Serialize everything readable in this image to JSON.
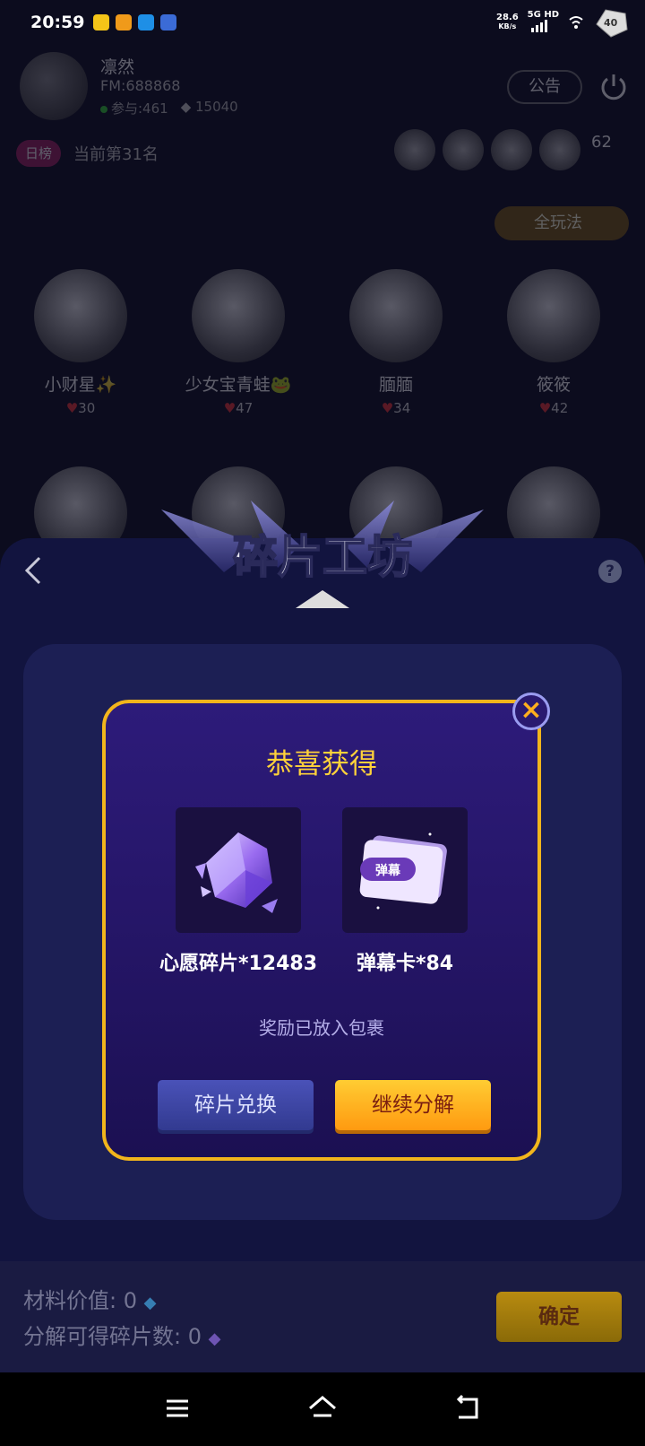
{
  "status_bar": {
    "time": "20:59",
    "net_speed": "28.6",
    "net_unit": "KB/s",
    "network": "5G HD",
    "battery": "40"
  },
  "room": {
    "host_name": "凛然",
    "host_id": "FM:688868",
    "participants": "参与:461",
    "diamonds": "15040",
    "notice_button": "公告",
    "rank_tag": "日榜",
    "rank_text": "当前第31名",
    "viewer_count": "62",
    "play_button": "全玩法",
    "seats": [
      {
        "name": "小财星✨",
        "hearts": "30"
      },
      {
        "name": "少女宝青蛙🐸",
        "hearts": "47"
      },
      {
        "name": "腼腼",
        "hearts": "34"
      },
      {
        "name": "筱筱",
        "hearts": "42"
      }
    ]
  },
  "workshop": {
    "title": "碎片工坊",
    "help": "?",
    "material_label": "材料价值:",
    "material_value": "0",
    "fragments_label": "分解可得碎片数:",
    "fragments_value": "0",
    "confirm_button": "确定"
  },
  "dialog": {
    "title": "恭喜获得",
    "rewards": [
      {
        "label": "心愿碎片*12483",
        "icon": "crystal-fragment-icon"
      },
      {
        "label": "弹幕卡*84",
        "icon": "danmaku-card-icon",
        "card_text": "弹幕"
      }
    ],
    "note": "奖励已放入包裹",
    "exchange_button": "碎片兑换",
    "continue_button": "继续分解",
    "close": "×"
  },
  "colors": {
    "dialog_border": "#f2b51c",
    "title_gold": "#ffd23a",
    "continue_orange": "#ff9a10",
    "exchange_blue": "#3a42a0"
  }
}
